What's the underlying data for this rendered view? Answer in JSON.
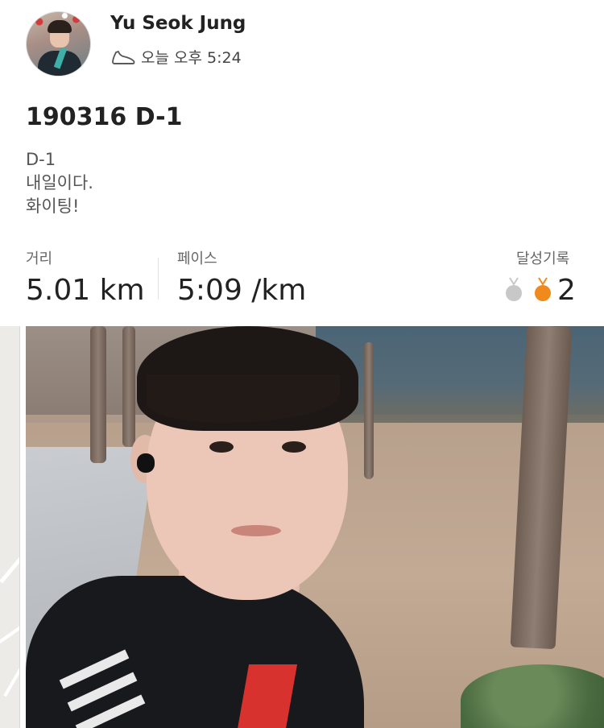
{
  "header": {
    "user_name": "Yu Seok Jung",
    "post_time": "오늘 오후 5:24",
    "time_icon": "running-shoe-icon"
  },
  "post": {
    "title": "190316 D-1",
    "body_lines": [
      "D-1",
      "내일이다.",
      "화이팅!"
    ]
  },
  "stats": {
    "distance": {
      "label": "거리",
      "value": "5.01 km"
    },
    "pace": {
      "label": "페이스",
      "value": "5:09 /km"
    },
    "achievements": {
      "label": "달성기록",
      "count": "2",
      "medal_colors": {
        "silver": "#c8c8c8",
        "bronze": "#f08a1c"
      }
    }
  },
  "colors": {
    "text_primary": "#222222",
    "text_secondary": "#666666",
    "divider": "#e2e2e2"
  }
}
